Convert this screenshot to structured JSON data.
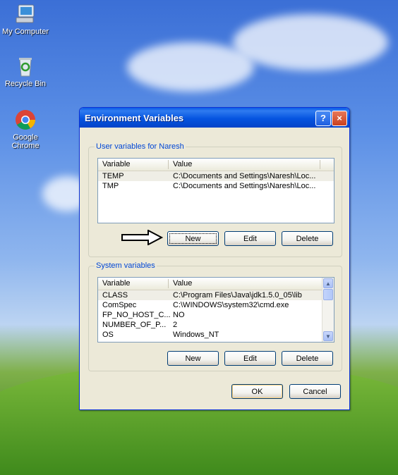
{
  "desktop": {
    "icons": [
      {
        "label": "My Computer"
      },
      {
        "label": "Recycle Bin"
      },
      {
        "label": "Google Chrome"
      }
    ]
  },
  "dialog": {
    "title": "Environment Variables",
    "help_label": "?",
    "close_label": "×",
    "user_group": {
      "label": "User variables for Naresh",
      "columns": [
        "Variable",
        "Value"
      ],
      "rows": [
        {
          "variable": "TEMP",
          "value": "C:\\Documents and Settings\\Naresh\\Loc..."
        },
        {
          "variable": "TMP",
          "value": "C:\\Documents and Settings\\Naresh\\Loc..."
        }
      ],
      "buttons": {
        "new": "New",
        "edit": "Edit",
        "delete": "Delete"
      }
    },
    "system_group": {
      "label": "System variables",
      "columns": [
        "Variable",
        "Value"
      ],
      "rows": [
        {
          "variable": "CLASS",
          "value": "C:\\Program Files\\Java\\jdk1.5.0_05\\lib"
        },
        {
          "variable": "ComSpec",
          "value": "C:\\WINDOWS\\system32\\cmd.exe"
        },
        {
          "variable": "FP_NO_HOST_C...",
          "value": "NO"
        },
        {
          "variable": "NUMBER_OF_P...",
          "value": "2"
        },
        {
          "variable": "OS",
          "value": "Windows_NT"
        }
      ],
      "buttons": {
        "new": "New",
        "edit": "Edit",
        "delete": "Delete"
      }
    },
    "ok_label": "OK",
    "cancel_label": "Cancel"
  },
  "annotation": {
    "icon": "arrow-right-icon"
  }
}
